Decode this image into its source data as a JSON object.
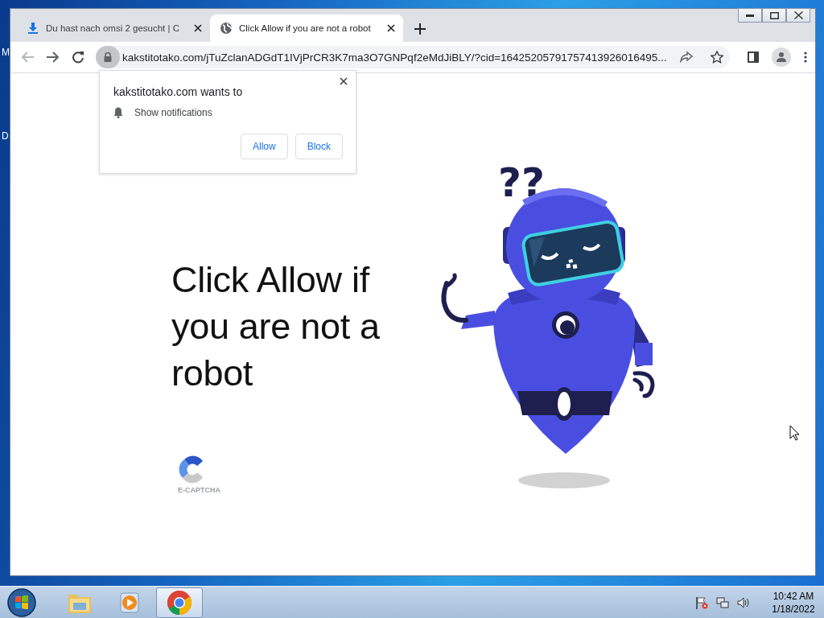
{
  "desktop": {
    "icon_labels": [
      "M",
      "D"
    ]
  },
  "browser": {
    "tabs": [
      {
        "title": "Du hast nach omsi 2 gesucht | C",
        "selected": false
      },
      {
        "title": "Click Allow if you are not a robot",
        "selected": true
      }
    ],
    "address": "kakstitotako.com/jTuZclanADGdT1IVjPrCR3K7ma3O7GNPqf2eMdJiBLY/?cid=16425205791757413926016495..."
  },
  "permission_popup": {
    "title": "kakstitotako.com wants to",
    "permission": "Show notifications",
    "buttons": [
      "Allow",
      "Block"
    ]
  },
  "page": {
    "headline": "Click Allow if you are not a robot",
    "thought": "??",
    "logo_caption": "E-CAPTCHA"
  },
  "taskbar": {
    "apps": [
      {
        "kind": "folder",
        "selected": false
      },
      {
        "kind": "media",
        "selected": false
      },
      {
        "kind": "chrome",
        "selected": true
      }
    ],
    "time": "10:42 AM",
    "date": "1/18/2022"
  }
}
